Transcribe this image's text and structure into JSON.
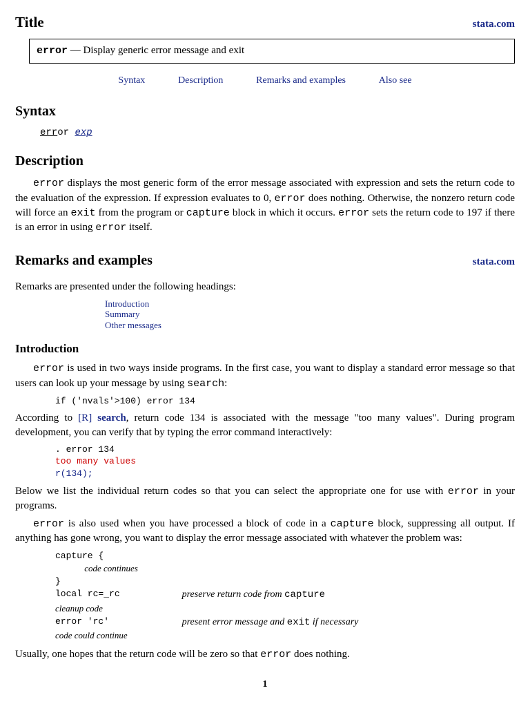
{
  "header": {
    "title_label": "Title",
    "site_link": "stata.com"
  },
  "title_box": {
    "command": "error",
    "dash": " — ",
    "summary": "Display generic error message and exit"
  },
  "nav": {
    "syntax": "Syntax",
    "description": "Description",
    "remarks": "Remarks and examples",
    "also_see": "Also see"
  },
  "syntax": {
    "heading": "Syntax",
    "cmd_underlined": "err",
    "cmd_rest": "or",
    "arg": "exp"
  },
  "description": {
    "heading": "Description",
    "p1a": "error",
    "p1b": " displays the most generic form of the error message associated with expression and sets the return code to the evaluation of the expression. If expression evaluates to 0, ",
    "p1c": "error",
    "p1d": " does nothing. Otherwise, the nonzero return code will force an ",
    "p1e": "exit",
    "p1f": " from the program or ",
    "p1g": "capture",
    "p1h": " block in which it occurs. ",
    "p1i": "error",
    "p1j": " sets the return code to 197 if there is an error in using ",
    "p1k": "error",
    "p1l": " itself."
  },
  "remarks": {
    "heading": "Remarks and examples",
    "site_link": "stata.com",
    "intro_line": "Remarks are presented under the following headings:",
    "toc": {
      "introduction": "Introduction",
      "summary": "Summary",
      "other": "Other messages"
    }
  },
  "intro": {
    "heading": "Introduction",
    "p1a": "error",
    "p1b": " is used in two ways inside programs. In the first case, you want to display a standard error message so that users can look up your message by using ",
    "p1c": "search",
    "p1d": ":",
    "code1": "if ('nvals'>100) error 134",
    "p2a": "According to ",
    "p2b_bracket": "[R]",
    "p2b_link": " search",
    "p2c": ", return code 134 is associated with the message \"too many values\". During program development, you can verify that by typing the error command interactively:",
    "code2_line1": ". error 134",
    "code2_line2": "too many values",
    "code2_line3": "r(134);",
    "p3a": "Below we list the individual return codes so that you can select the appropriate one for use with ",
    "p3b": "error",
    "p3c": " in your programs.",
    "p4a": "error",
    "p4b": " is also used when you have processed a block of code in a ",
    "p4c": "capture",
    "p4d": " block, suppressing all output. If anything has gone wrong, you want to display the error message associated with whatever the problem was:",
    "code3": {
      "l1": "capture {",
      "l2": "        code continues",
      "l3": "}",
      "l4": "local rc=_rc",
      "l4_comment_a": "preserve return code from ",
      "l4_comment_b": "capture",
      "l5": "cleanup code",
      "l6": "error 'rc'",
      "l6_comment_a": "present error message and ",
      "l6_comment_b": "exit",
      "l6_comment_c": " if necessary",
      "l7": "code could continue"
    },
    "p5a": "Usually, one hopes that the return code will be zero so that ",
    "p5b": "error",
    "p5c": " does nothing."
  },
  "page_number": "1"
}
